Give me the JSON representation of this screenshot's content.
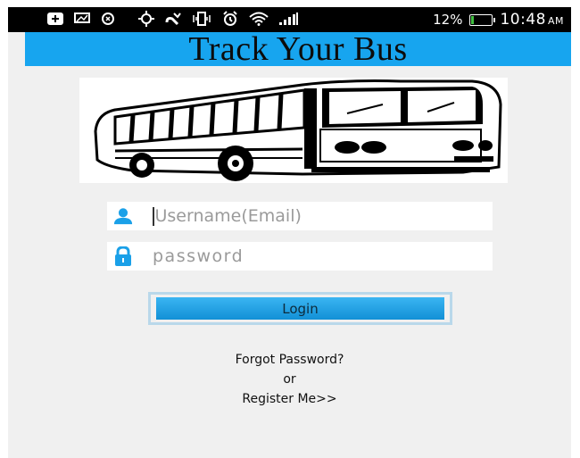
{
  "status_bar": {
    "icons": [
      "plus-icon",
      "message-icon",
      "sync-icon",
      "gps-icon",
      "missed-call-icon",
      "vibrate-icon",
      "alarm-icon",
      "wifi-icon",
      "signal-icon",
      "battery-icon"
    ],
    "battery": "12%",
    "battery_level": 0.12,
    "time": "10:48",
    "ampm": "AM"
  },
  "header": {
    "title": "Track Your Bus",
    "color": "#17a5ef"
  },
  "login_form": {
    "username_placeholder": "Username(Email)",
    "password_placeholder": "password",
    "login_label": "Login"
  },
  "links": {
    "forgot": "Forgot Password?",
    "or": "or",
    "register": "Register Me>>"
  },
  "colors": {
    "accent": "#17a5ef",
    "button": "#1a9ae0",
    "background": "#f0f0f0"
  }
}
